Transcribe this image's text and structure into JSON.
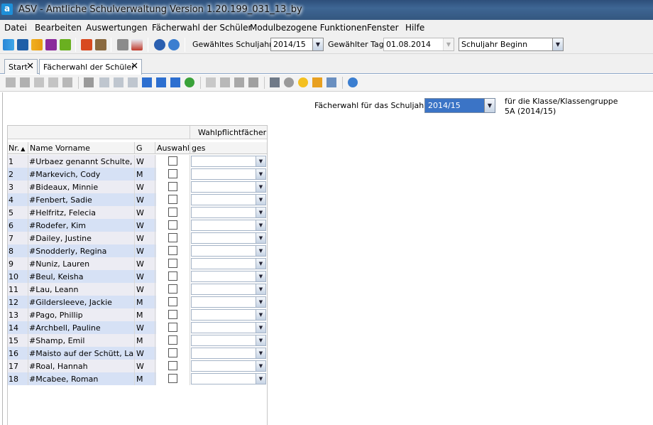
{
  "window": {
    "title": "ASV - Amtliche Schulverwaltung Version 1.20.199_031_13_by"
  },
  "menu": [
    "Datei",
    "Bearbeiten",
    "Auswertungen",
    "Fächerwahl der Schüler",
    "Modulbezogene Funktionen",
    "Fenster",
    "Hilfe"
  ],
  "toolbar": {
    "schuljahr_label": "Gewähltes Schuljahr",
    "schuljahr_value": "2014/15",
    "tag_label": "Gewählter Tag",
    "tag_value": "01.08.2014",
    "period_value": "Schuljahr Beginn"
  },
  "tabs": [
    {
      "label": "Start",
      "close": "✕"
    },
    {
      "label": "Fächerwahl der Schüler",
      "close": "✕"
    }
  ],
  "form": {
    "year_label": "Fächerwahl für das Schuljahr",
    "year_value": "2014/15",
    "class_label": "für die Klasse/Klassengruppe",
    "class_value": "5A (2014/15)"
  },
  "table": {
    "group_header": "Wahlpflichtfächer",
    "columns": {
      "nr": "Nr.",
      "name": "Name Vorname",
      "g": "G",
      "auswahl": "Auswahl",
      "ges": "ges"
    },
    "rows": [
      {
        "nr": "1",
        "name": "#Urbaez genannt Schulte, ...",
        "g": "W"
      },
      {
        "nr": "2",
        "name": "#Markevich, Cody",
        "g": "M"
      },
      {
        "nr": "3",
        "name": "#Bideaux, Minnie",
        "g": "W"
      },
      {
        "nr": "4",
        "name": "#Fenbert, Sadie",
        "g": "W"
      },
      {
        "nr": "5",
        "name": "#Helfritz, Felecia",
        "g": "W"
      },
      {
        "nr": "6",
        "name": "#Rodefer, Kim",
        "g": "W"
      },
      {
        "nr": "7",
        "name": "#Dailey, Justine",
        "g": "W"
      },
      {
        "nr": "8",
        "name": "#Snodderly, Regina",
        "g": "W"
      },
      {
        "nr": "9",
        "name": "#Nuniz, Lauren",
        "g": "W"
      },
      {
        "nr": "10",
        "name": "#Beul, Keisha",
        "g": "W"
      },
      {
        "nr": "11",
        "name": "#Lau, Leann",
        "g": "W"
      },
      {
        "nr": "12",
        "name": "#Gildersleeve, Jackie",
        "g": "M"
      },
      {
        "nr": "13",
        "name": "#Pago, Phillip",
        "g": "M"
      },
      {
        "nr": "14",
        "name": "#Archbell, Pauline",
        "g": "W"
      },
      {
        "nr": "15",
        "name": "#Shamp, Emil",
        "g": "M"
      },
      {
        "nr": "16",
        "name": "#Maisto auf der Schütt, La...",
        "g": "W"
      },
      {
        "nr": "17",
        "name": "#Roal, Hannah",
        "g": "W"
      },
      {
        "nr": "18",
        "name": "#Mcabee, Roman",
        "g": "M"
      }
    ]
  },
  "icons": {
    "app": "a",
    "dropdown": "▼",
    "sort_asc": "▲"
  }
}
